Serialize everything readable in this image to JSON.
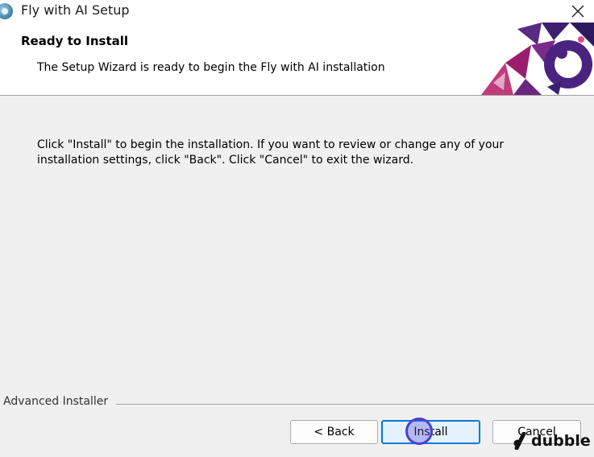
{
  "window": {
    "title": "Fly with AI Setup",
    "icon": "app-disc-icon",
    "close_icon": "close-icon"
  },
  "header": {
    "title": "Ready to Install",
    "subtitle": "The Setup Wizard is ready to begin the Fly with AI installation",
    "banner_colors": [
      "#3c1f6e",
      "#9b1e6e",
      "#5a2b82",
      "#c23b7a"
    ]
  },
  "body": {
    "line1": "Click \"Install\" to begin the installation.  If you want to review or change any of your",
    "line2": "installation settings, click \"Back\".  Click \"Cancel\" to exit the wizard."
  },
  "footer": {
    "brand": "Advanced Installer",
    "buttons": {
      "back": "< Back",
      "install": "Install",
      "cancel": "Cancel"
    }
  },
  "watermark": {
    "text": "dubble"
  }
}
